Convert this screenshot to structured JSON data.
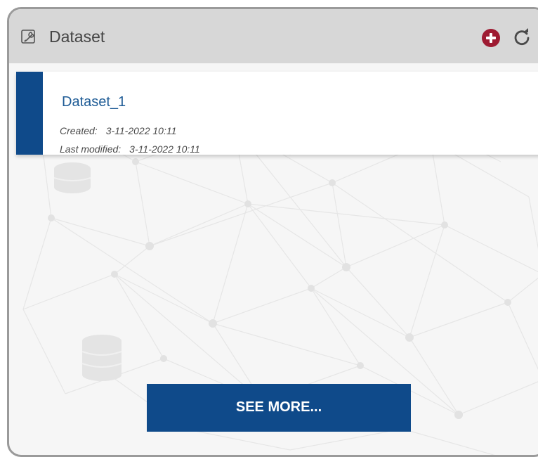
{
  "header": {
    "title": "Dataset",
    "icon": "wrench-icon",
    "add_icon": "add-circle-icon",
    "refresh_icon": "refresh-icon"
  },
  "datasets": [
    {
      "name": "Dataset_1",
      "created_label": "Created:",
      "created_value": "3-11-2022 10:11",
      "modified_label": "Last modified:",
      "modified_value": "3-11-2022 10:11"
    }
  ],
  "footer": {
    "see_more_label": "SEE MORE..."
  },
  "colors": {
    "accent": "#0f4a8a",
    "add_button": "#9e1b32",
    "header_bg": "#d7d7d7",
    "link_text": "#1f5c96"
  }
}
